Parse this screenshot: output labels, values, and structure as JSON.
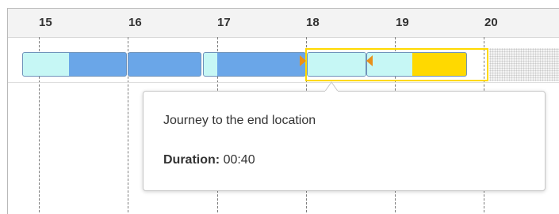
{
  "timeline": {
    "hours": [
      "15",
      "16",
      "17",
      "18",
      "19",
      "20"
    ]
  },
  "colors": {
    "travel_light": "#c6f7f5",
    "work_blue": "#6aa6e8",
    "selected_yellow": "#ffd900",
    "marker_orange": "#e8901a"
  },
  "tooltip": {
    "title": "Journey to the end location",
    "duration_label": "Duration:",
    "duration_value": "00:40"
  }
}
